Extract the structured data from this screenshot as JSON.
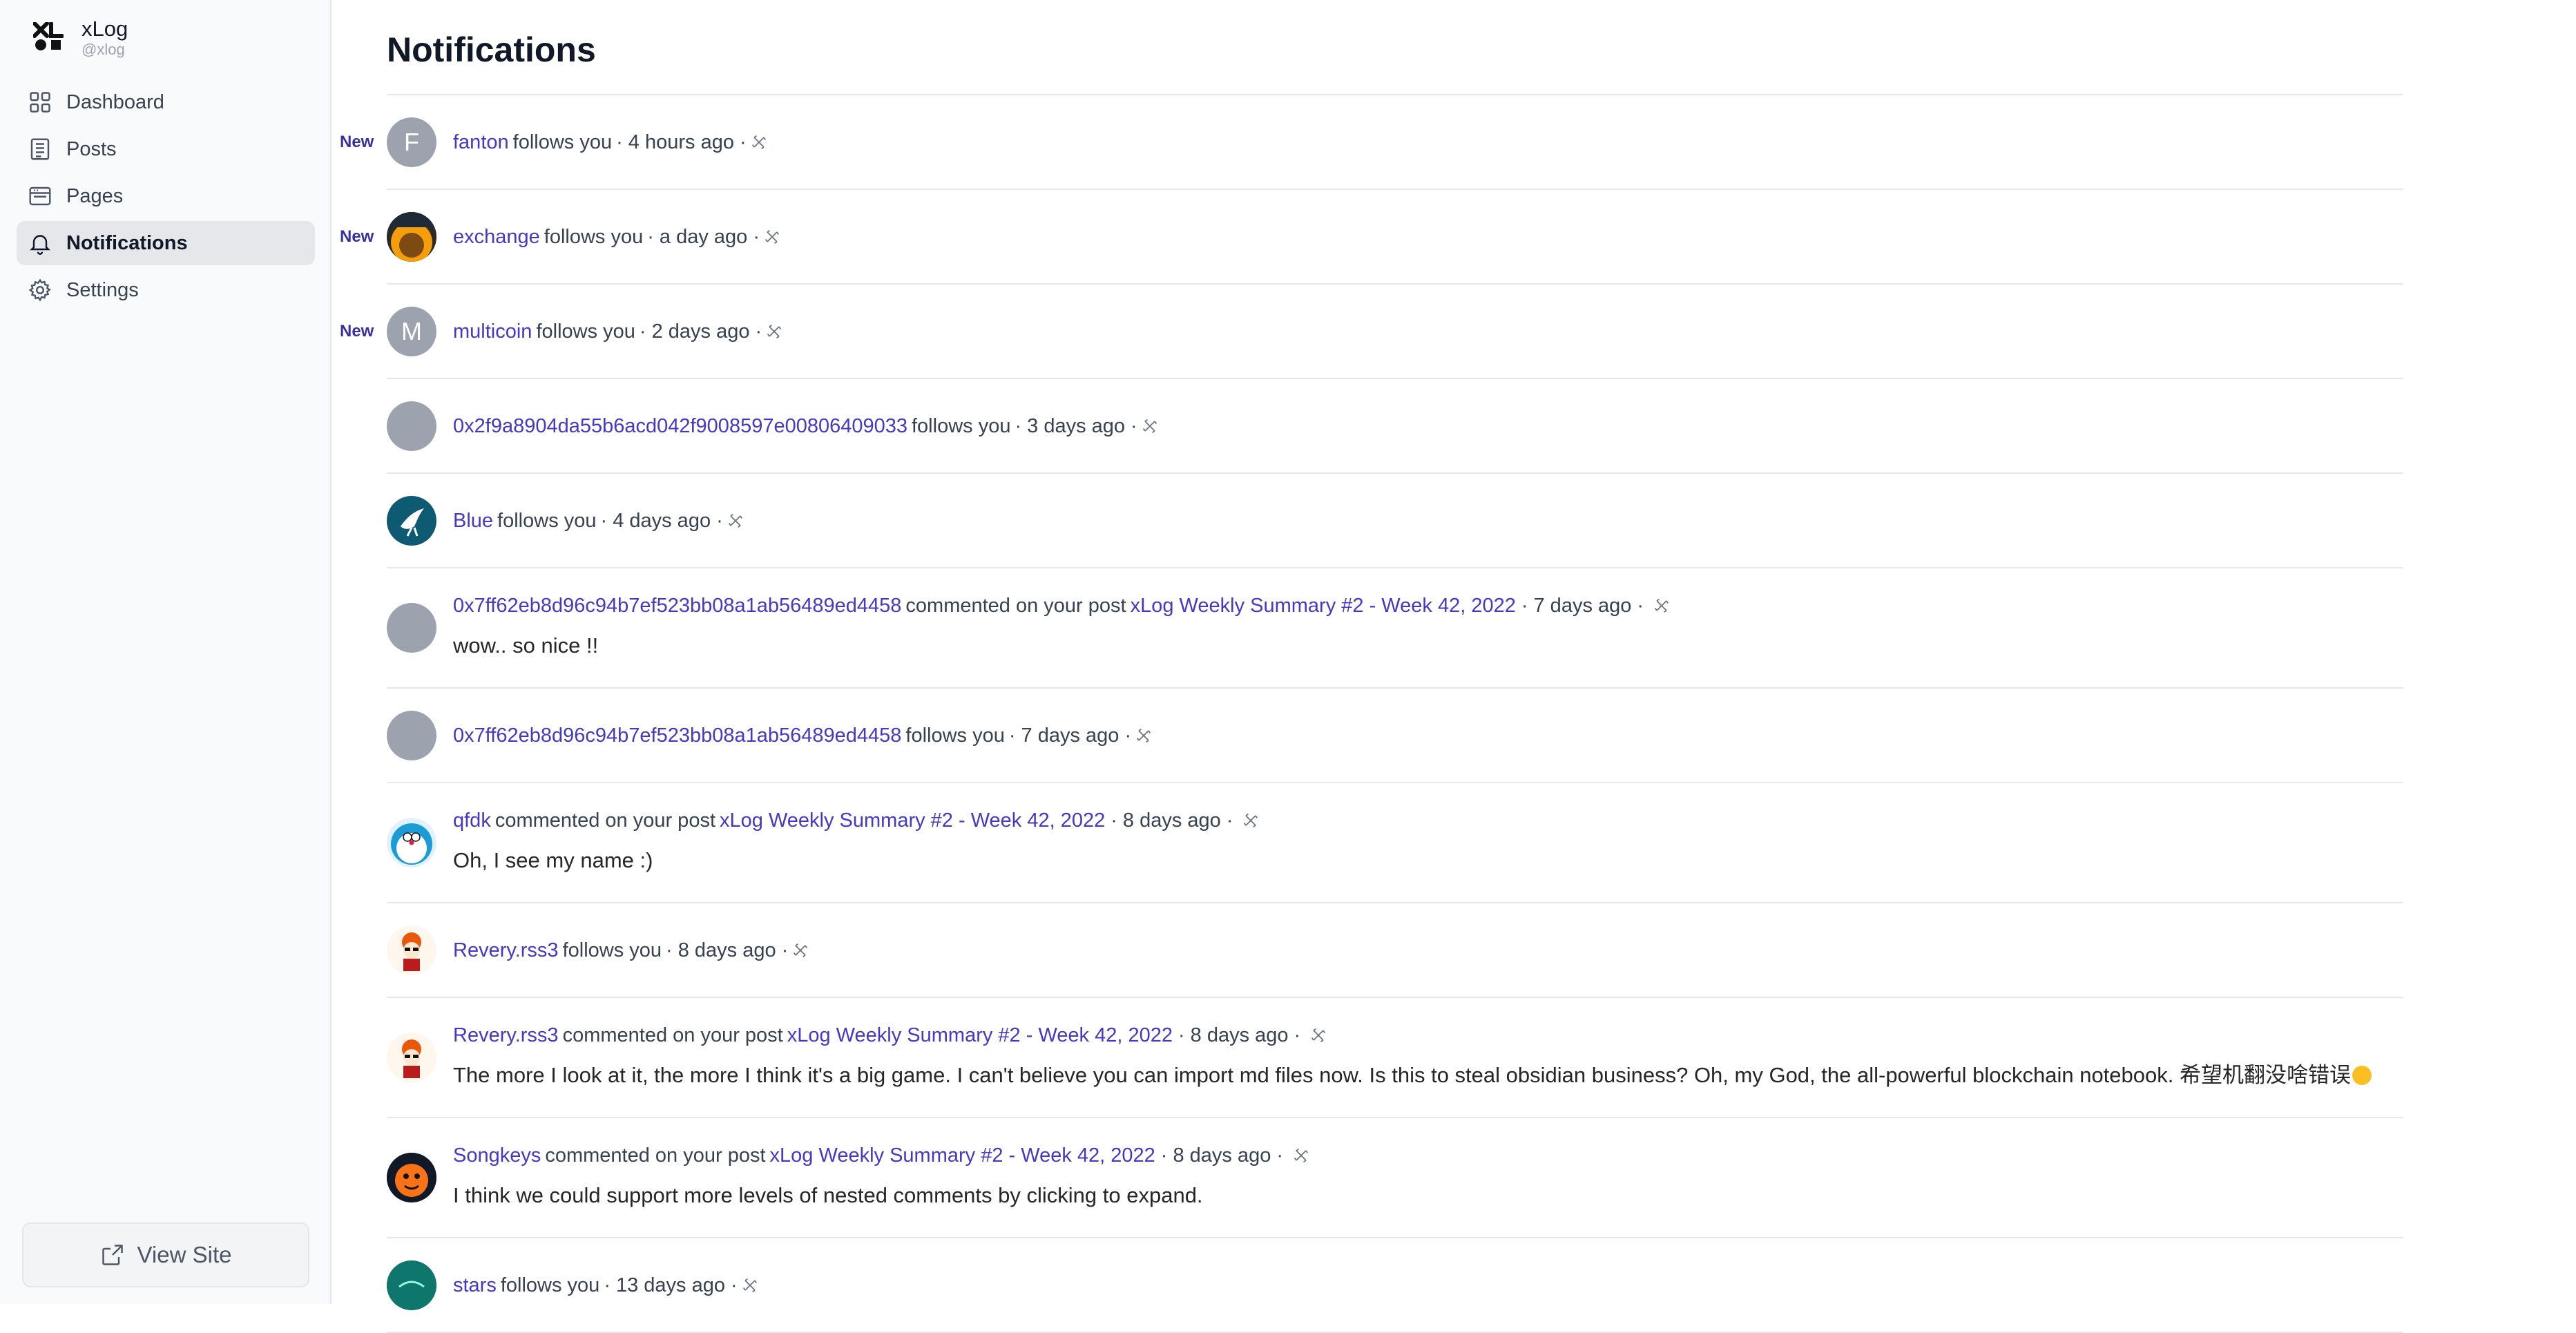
{
  "app": {
    "name": "xLog",
    "handle": "@xlog"
  },
  "sidebar": {
    "items": [
      {
        "label": "Dashboard",
        "icon": "dashboard-icon",
        "active": false
      },
      {
        "label": "Posts",
        "icon": "posts-icon",
        "active": false
      },
      {
        "label": "Pages",
        "icon": "pages-icon",
        "active": false
      },
      {
        "label": "Notifications",
        "icon": "bell-icon",
        "active": true
      },
      {
        "label": "Settings",
        "icon": "gear-icon",
        "active": false
      }
    ],
    "view_site": "View Site"
  },
  "main": {
    "title": "Notifications"
  },
  "notifications": [
    {
      "new": "New",
      "avatar_letter": "F",
      "user": "fanton",
      "action": "follows you",
      "time": "4 hours ago"
    },
    {
      "new": "New",
      "user": "exchange",
      "action": "follows you",
      "time": "a day ago"
    },
    {
      "new": "New",
      "avatar_letter": "M",
      "user": "multicoin",
      "action": "follows you",
      "time": "2 days ago"
    },
    {
      "user": "0x2f9a8904da55b6acd042f9008597e00806409033",
      "action": "follows you",
      "time": "3 days ago"
    },
    {
      "user": "Blue",
      "action": "follows you",
      "time": "4 days ago"
    },
    {
      "user": "0x7ff62eb8d96c94b7ef523bb08a1ab56489ed4458",
      "action": "commented on your post",
      "post": "xLog Weekly Summary #2 - Week 42, 2022",
      "time": "7 days ago",
      "comment": "wow.. so nice !!"
    },
    {
      "user": "0x7ff62eb8d96c94b7ef523bb08a1ab56489ed4458",
      "action": "follows you",
      "time": "7 days ago"
    },
    {
      "user": "qfdk",
      "action": "commented on your post",
      "post": "xLog Weekly Summary #2 - Week 42, 2022",
      "time": "8 days ago",
      "comment": "Oh, I see my name :)"
    },
    {
      "user": "Revery.rss3",
      "action": "follows you",
      "time": "8 days ago"
    },
    {
      "user": "Revery.rss3",
      "action": "commented on your post",
      "post": "xLog Weekly Summary #2 - Week 42, 2022",
      "time": "8 days ago",
      "comment": "The more I look at it, the more I think it's a big game. I can't believe you can import md files now. Is this to steal obsidian business? Oh, my God, the all-powerful blockchain notebook. 希望机翻没啥错误"
    },
    {
      "user": "Songkeys",
      "action": "commented on your post",
      "post": "xLog Weekly Summary #2 - Week 42, 2022",
      "time": "8 days ago",
      "comment": "I think we could support more levels of nested comments by clicking to expand."
    },
    {
      "user": "stars",
      "action": "follows you",
      "time": "13 days ago"
    }
  ],
  "separator": "·",
  "colors": {
    "link": "#4338ca",
    "new_badge": "#3730a3",
    "active_nav": "#e5e7eb",
    "avatar_placeholder": "#9ca3af"
  }
}
